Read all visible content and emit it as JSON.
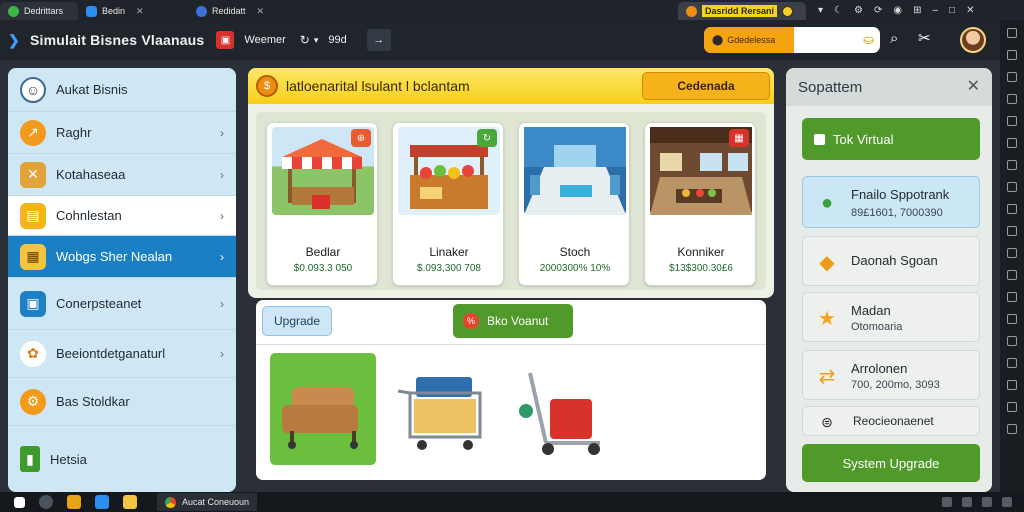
{
  "browser_tabs": [
    {
      "label": "Dedrittars",
      "icon": "green-globe-icon",
      "color": "#3bb54a"
    },
    {
      "label": "Bedin",
      "icon": "blue-app-icon",
      "color": "#2b8ef0"
    },
    {
      "label": "Redidatt",
      "icon": "blue-circle-icon",
      "color": "#3c6fd8"
    }
  ],
  "active_tab": {
    "label": "Dasridd Rersani",
    "icon": "orange-circle-icon"
  },
  "header": {
    "title": "Simulait Bisnes Vlaanaus",
    "mode": "Weemer",
    "value": "99d",
    "search_tag": "Gdedelessa"
  },
  "sidebar": {
    "items": [
      {
        "label": "Aukat Bisnis",
        "icon": "avatar-icon",
        "chevron": false,
        "style": "plain"
      },
      {
        "label": "Raghr",
        "icon": "chart-icon",
        "chevron": true,
        "style": "plain"
      },
      {
        "label": "Kotahaseaa",
        "icon": "box-icon",
        "chevron": true,
        "style": "plain"
      },
      {
        "label": "Cohnlestan",
        "icon": "document-icon",
        "chevron": true,
        "style": "white"
      },
      {
        "label": "Wobgs Sher Nealan",
        "icon": "store-icon",
        "chevron": true,
        "style": "active"
      },
      {
        "label": "Conerpsteanet",
        "icon": "panel-icon",
        "chevron": true,
        "style": "plain"
      },
      {
        "label": "Beeiontdetganaturl",
        "icon": "leaf-icon",
        "chevron": true,
        "style": "plain"
      },
      {
        "label": "Bas Stoldkar",
        "icon": "gear-icon",
        "chevron": false,
        "style": "plain"
      },
      {
        "label": "Hetsia",
        "icon": "battery-icon",
        "chevron": false,
        "style": "plain"
      }
    ]
  },
  "banner": {
    "title": "latloenarital lsulant l bclantam",
    "button": "Cedenada"
  },
  "shops": [
    {
      "name": "Bedlar",
      "price": "$0.093.3 050",
      "badge_color": "#e95b30"
    },
    {
      "name": "Linaker",
      "price": "$.093,300 708",
      "badge_color": "#4aa83a"
    },
    {
      "name": "Stoch",
      "price": "2000300% 10%",
      "badge_color": "#2b80c7"
    },
    {
      "name": "Konniker",
      "price": "$13$300.30£6",
      "badge_color": "#d9322c"
    }
  ],
  "bottom_panel": {
    "upgrade_tab": "Upgrade",
    "buy_button": "Bko Voanut"
  },
  "items": [
    {
      "icon": "armchair-icon"
    },
    {
      "icon": "shopping-cart-icon"
    },
    {
      "icon": "hand-truck-icon"
    }
  ],
  "right_panel": {
    "title": "Sopattem",
    "top_button": "Tok Virtual",
    "stats": [
      {
        "name": "Fnailo Sppotrank",
        "value": "89£1601, 7000390",
        "icon": "message-icon",
        "color": "#3aa03a"
      },
      {
        "name": "Daonah Sgoan",
        "value": "",
        "icon": "tag-icon",
        "color": "#f09a1a"
      },
      {
        "name": "Madan",
        "value": "Otomoaria",
        "icon": "star-icon",
        "color": "#f3a520"
      },
      {
        "name": "Arrolonen",
        "value": "700, 200mo, 3093",
        "icon": "route-icon",
        "color": "#f09a1a"
      },
      {
        "name": "Reocieonaenet",
        "value": "",
        "icon": "lock-icon",
        "color": "#222222"
      }
    ],
    "upgrade_button": "System Upgrade"
  },
  "taskbar": {
    "app_label": "Aucat Coneuoun"
  },
  "colors": {
    "accent_green": "#4f9a2a",
    "sidebar_active": "#1b7fc4",
    "banner_yellow": "#f5cf1a"
  }
}
